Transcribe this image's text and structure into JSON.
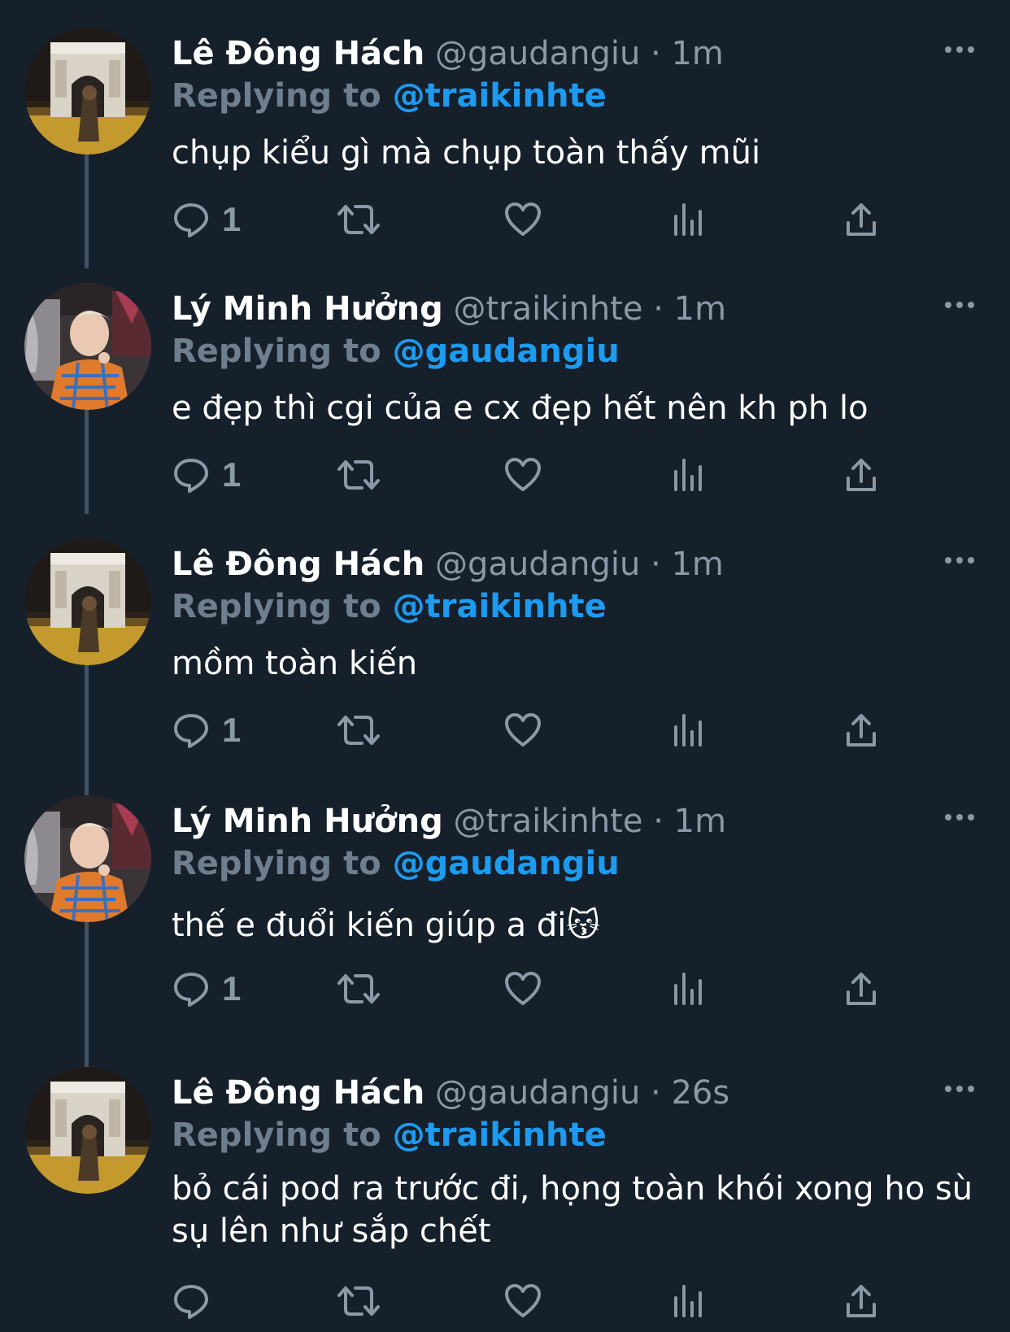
{
  "tweets": [
    {
      "name": "Lê Đông Hách",
      "handle": "@gaudangiu",
      "dot": "·",
      "time": "1m",
      "replying_label": "Replying to",
      "replying_to": "@traikinhte",
      "text": "chụp kiểu gì mà chụp toàn thấy mũi",
      "reply_count": "1",
      "avatar": "arch-night-photo"
    },
    {
      "name": "Lý Minh Hưởng",
      "handle": "@traikinhte",
      "dot": "·",
      "time": "1m",
      "replying_label": "Replying to",
      "replying_to": "@gaudangiu",
      "text": "e đẹp thì cgi của e cx đẹp hết nên kh ph lo",
      "reply_count": "1",
      "avatar": "person-orange-jacket-photo"
    },
    {
      "name": "Lê Đông Hách",
      "handle": "@gaudangiu",
      "dot": "·",
      "time": "1m",
      "replying_label": "Replying to",
      "replying_to": "@traikinhte",
      "text": "mồm toàn kiến",
      "reply_count": "1",
      "avatar": "arch-night-photo"
    },
    {
      "name": "Lý Minh Hưởng",
      "handle": "@traikinhte",
      "dot": "·",
      "time": "1m",
      "replying_label": "Replying to",
      "replying_to": "@gaudangiu",
      "text": "thế e đuổi kiến giúp a đi😽",
      "reply_count": "1",
      "avatar": "person-orange-jacket-photo"
    },
    {
      "name": "Lê Đông Hách",
      "handle": "@gaudangiu",
      "dot": "·",
      "time": "26s",
      "replying_label": "Replying to",
      "replying_to": "@traikinhte",
      "text": "bỏ cái pod ra trước đi, họng toàn khói xong ho sù sụ lên như sắp chết",
      "reply_count": "",
      "avatar": "arch-night-photo"
    }
  ],
  "icons": {
    "more": "more-horizontal-icon",
    "reply": "reply-bubble-icon",
    "retweet": "retweet-icon",
    "like": "heart-icon",
    "views": "bar-chart-icon",
    "share": "share-upload-icon"
  },
  "colors": {
    "background": "#15202b",
    "text": "#ffffff",
    "secondary": "#8b98a5",
    "mention": "#1d9bf0",
    "thread_line": "#3d5466"
  }
}
